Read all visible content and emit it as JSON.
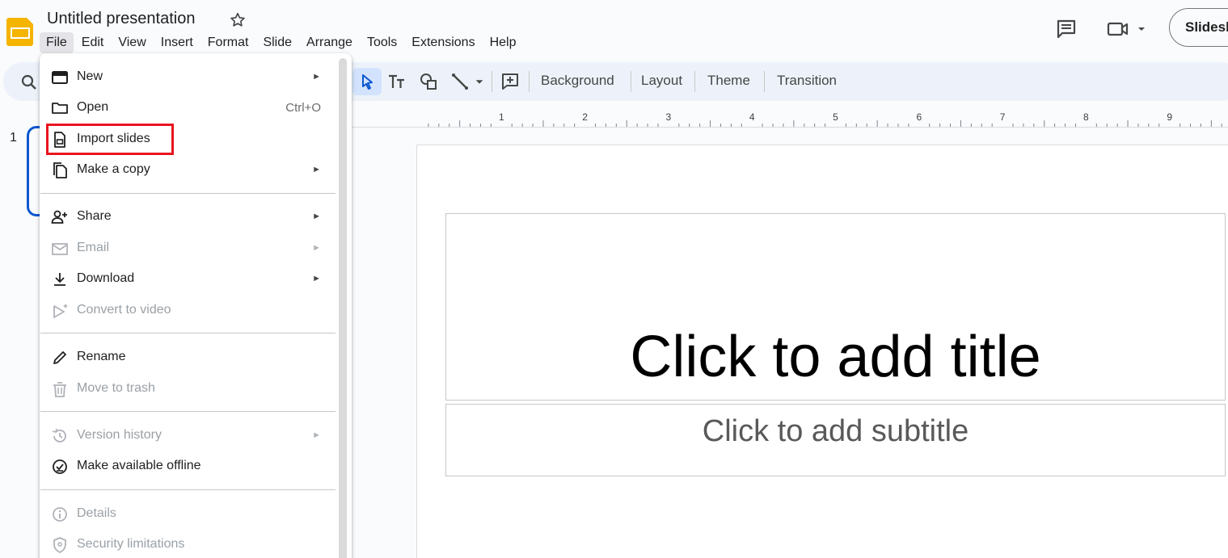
{
  "header": {
    "doc_title": "Untitled presentation",
    "menus": [
      "File",
      "Edit",
      "View",
      "Insert",
      "Format",
      "Slide",
      "Arrange",
      "Tools",
      "Extensions",
      "Help"
    ],
    "active_menu": "File",
    "slideshow_label": "Slidesh"
  },
  "toolbar": {
    "background_label": "Background",
    "layout_label": "Layout",
    "theme_label": "Theme",
    "transition_label": "Transition"
  },
  "ruler": {
    "ticks": [
      "1",
      "2",
      "3",
      "4",
      "5",
      "6",
      "7",
      "8",
      "9"
    ]
  },
  "filmstrip": {
    "slide_number": "1"
  },
  "slide": {
    "title_placeholder": "Click to add title",
    "subtitle_placeholder": "Click to add subtitle"
  },
  "file_menu": {
    "items": [
      {
        "label": "New",
        "icon": "new-presentation-icon",
        "submenu": true,
        "disabled": false
      },
      {
        "label": "Open",
        "icon": "folder-icon",
        "shortcut": "Ctrl+O",
        "disabled": false
      },
      {
        "label": "Import slides",
        "icon": "import-slides-icon",
        "disabled": false,
        "highlighted": true
      },
      {
        "label": "Make a copy",
        "icon": "copy-icon",
        "submenu": true,
        "disabled": false
      },
      {
        "label": "Share",
        "icon": "share-person-icon",
        "submenu": true,
        "disabled": false
      },
      {
        "label": "Email",
        "icon": "email-icon",
        "submenu": true,
        "disabled": true
      },
      {
        "label": "Download",
        "icon": "download-icon",
        "submenu": true,
        "disabled": false
      },
      {
        "label": "Convert to video",
        "icon": "video-sparkle-icon",
        "disabled": true
      },
      {
        "label": "Rename",
        "icon": "pencil-icon",
        "disabled": false
      },
      {
        "label": "Move to trash",
        "icon": "trash-icon",
        "disabled": true
      },
      {
        "label": "Version history",
        "icon": "history-icon",
        "submenu": true,
        "disabled": true
      },
      {
        "label": "Make available offline",
        "icon": "offline-check-icon",
        "disabled": false
      },
      {
        "label": "Details",
        "icon": "info-icon",
        "disabled": true
      },
      {
        "label": "Security limitations",
        "icon": "shield-icon",
        "disabled": true
      }
    ]
  },
  "colors": {
    "highlight": "#e8141e",
    "accent": "#0b57d0",
    "selected_tool": "#d3e3fd",
    "logo": "#f4b400"
  }
}
